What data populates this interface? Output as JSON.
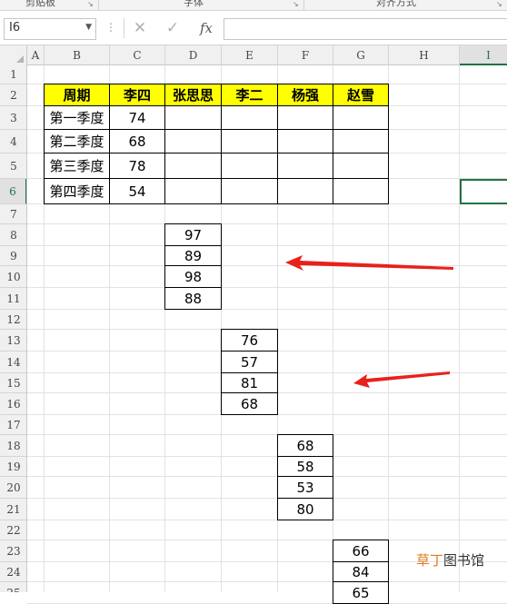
{
  "ribbon": {
    "groups": [
      {
        "label": "剪贴板",
        "launcher": "↘"
      },
      {
        "label": "字体",
        "launcher": "↘"
      },
      {
        "label": "对齐方式",
        "launcher": "↘"
      }
    ]
  },
  "formula_bar": {
    "name_box_value": "I6",
    "cancel_icon": "✕",
    "confirm_icon": "✓",
    "fx_label": "fx",
    "formula_value": ""
  },
  "grid": {
    "columns": [
      "A",
      "B",
      "C",
      "D",
      "E",
      "F",
      "G",
      "H",
      "I"
    ],
    "selected_column": "I",
    "rows": [
      "1",
      "2",
      "3",
      "4",
      "5",
      "6",
      "7",
      "8",
      "9",
      "10",
      "11",
      "12",
      "13",
      "14",
      "15",
      "16",
      "17",
      "18",
      "19",
      "20",
      "21",
      "22",
      "23",
      "24",
      "25"
    ],
    "selected_row": "6"
  },
  "main_table": {
    "headers": [
      "周期",
      "李四",
      "张思思",
      "李二",
      "杨强",
      "赵雪"
    ],
    "rows": [
      {
        "label": "第一季度",
        "value": "74"
      },
      {
        "label": "第二季度",
        "value": "68"
      },
      {
        "label": "第三季度",
        "value": "78"
      },
      {
        "label": "第四季度",
        "value": "54"
      }
    ]
  },
  "blocks": [
    {
      "column": "D",
      "values": [
        "97",
        "89",
        "98",
        "88"
      ]
    },
    {
      "column": "E",
      "values": [
        "76",
        "57",
        "81",
        "68"
      ]
    },
    {
      "column": "F",
      "values": [
        "68",
        "58",
        "53",
        "80"
      ]
    },
    {
      "column": "G",
      "values": [
        "66",
        "84",
        "65"
      ]
    }
  ],
  "watermark": {
    "highlight": "草丁",
    "rest": "图书馆"
  },
  "colors": {
    "header_fill": "#ffff00",
    "selection": "#217346",
    "arrow": "#e8211b"
  }
}
